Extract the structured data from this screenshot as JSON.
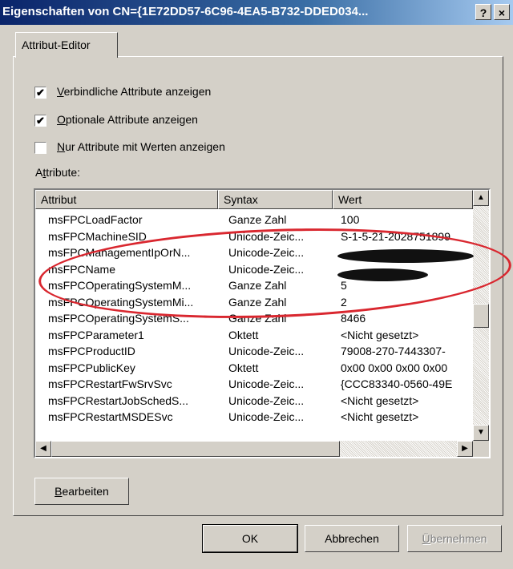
{
  "window": {
    "title": "Eigenschaften von CN={1E72DD57-6C96-4EA5-B732-DDED034...",
    "help_button": "?",
    "close_button": "×"
  },
  "tabs": [
    {
      "label": "Attribut-Editor",
      "active": true
    }
  ],
  "options": [
    {
      "prefix": "",
      "accel": "V",
      "rest": "erbindliche Attribute anzeigen",
      "checked": true,
      "mark": "✔"
    },
    {
      "prefix": "",
      "accel": "O",
      "rest": "ptionale Attribute anzeigen",
      "checked": true,
      "mark": "✔"
    },
    {
      "prefix": "",
      "accel": "N",
      "rest": "ur Attribute mit Werten anzeigen",
      "checked": false,
      "mark": ""
    }
  ],
  "attributes_label": {
    "prefix": "A",
    "accel": "t",
    "rest": "tribute:"
  },
  "table": {
    "columns": [
      "Attribut",
      "Syntax",
      "Wert"
    ],
    "rows": [
      {
        "attr": "msFPCLoadFactor",
        "syntax": "Ganze Zahl",
        "value": "100"
      },
      {
        "attr": "msFPCMachineSID",
        "syntax": "Unicode-Zeic...",
        "value": "S-1-5-21-2028751899"
      },
      {
        "attr": "msFPCManagementIpOrN...",
        "syntax": "Unicode-Zeic...",
        "value": ""
      },
      {
        "attr": "msFPCName",
        "syntax": "Unicode-Zeic...",
        "value": ""
      },
      {
        "attr": "msFPCOperatingSystemM...",
        "syntax": "Ganze Zahl",
        "value": "5"
      },
      {
        "attr": "msFPCOperatingSystemMi...",
        "syntax": "Ganze Zahl",
        "value": "2"
      },
      {
        "attr": "msFPCOperatingSystemS...",
        "syntax": "Ganze Zahl",
        "value": "8466"
      },
      {
        "attr": "msFPCParameter1",
        "syntax": "Oktett",
        "value": "<Nicht gesetzt>"
      },
      {
        "attr": "msFPCProductID",
        "syntax": "Unicode-Zeic...",
        "value": "79008-270-7443307-"
      },
      {
        "attr": "msFPCPublicKey",
        "syntax": "Oktett",
        "value": "0x00 0x00 0x00 0x00"
      },
      {
        "attr": "msFPCRestartFwSrvSvc",
        "syntax": "Unicode-Zeic...",
        "value": "{CCC83340-0560-49E"
      },
      {
        "attr": "msFPCRestartJobSchedS...",
        "syntax": "Unicode-Zeic...",
        "value": "<Nicht gesetzt>"
      },
      {
        "attr": "msFPCRestartMSDESvc",
        "syntax": "Unicode-Zeic...",
        "value": "<Nicht gesetzt>"
      }
    ]
  },
  "scroll": {
    "up": "▲",
    "down": "▼",
    "left": "◀",
    "right": "▶"
  },
  "edit_button": {
    "accel": "B",
    "rest": "earbeiten"
  },
  "footer": {
    "ok": "OK",
    "cancel": "Abbrechen",
    "apply_accel": "Ü",
    "apply_rest": "bernehmen"
  },
  "colors": {
    "annotation": "#d9272f",
    "titlebar_start": "#0a246a",
    "face": "#d4d0c8"
  }
}
